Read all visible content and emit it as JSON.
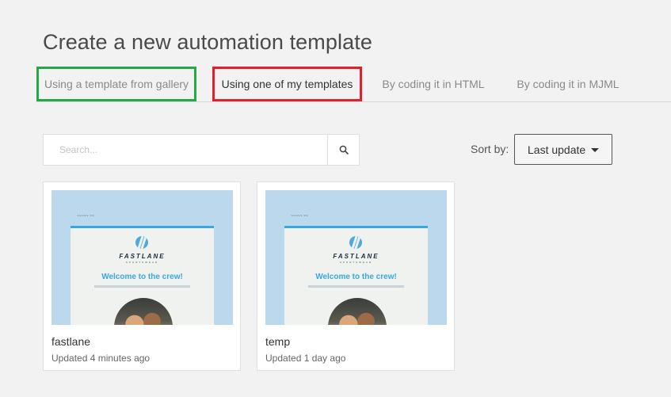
{
  "page": {
    "title": "Create a new automation template"
  },
  "tabs": [
    {
      "label": "Using a template from gallery",
      "active": false,
      "highlight": "#25a845"
    },
    {
      "label": "Using one of my templates",
      "active": true,
      "highlight": "#e0202a"
    },
    {
      "label": "By coding it in HTML",
      "active": false
    },
    {
      "label": "By coding it in MJML",
      "active": false
    }
  ],
  "search": {
    "placeholder": "Search...",
    "value": "",
    "icon": "search-icon"
  },
  "sort": {
    "label": "Sort by:",
    "selected": "Last update",
    "icon": "caret-down-icon"
  },
  "templates": [
    {
      "name": "fastlane",
      "updated": "Updated 4 minutes ago",
      "thumbnail": {
        "brand": "FASTLANE",
        "brand_sub": "SPORTSWEAR",
        "headline": "Welcome to the crew!"
      }
    },
    {
      "name": "temp",
      "updated": "Updated 1 day ago",
      "thumbnail": {
        "brand": "FASTLANE",
        "brand_sub": "SPORTSWEAR",
        "headline": "Welcome to the crew!"
      }
    }
  ],
  "colors": {
    "background": "#f2f2f2",
    "gallery_highlight": "#25a845",
    "my_templates_highlight": "#e0202a",
    "thumbnail_bg": "#bcd8ec",
    "accent_blue": "#3aa7e0"
  }
}
